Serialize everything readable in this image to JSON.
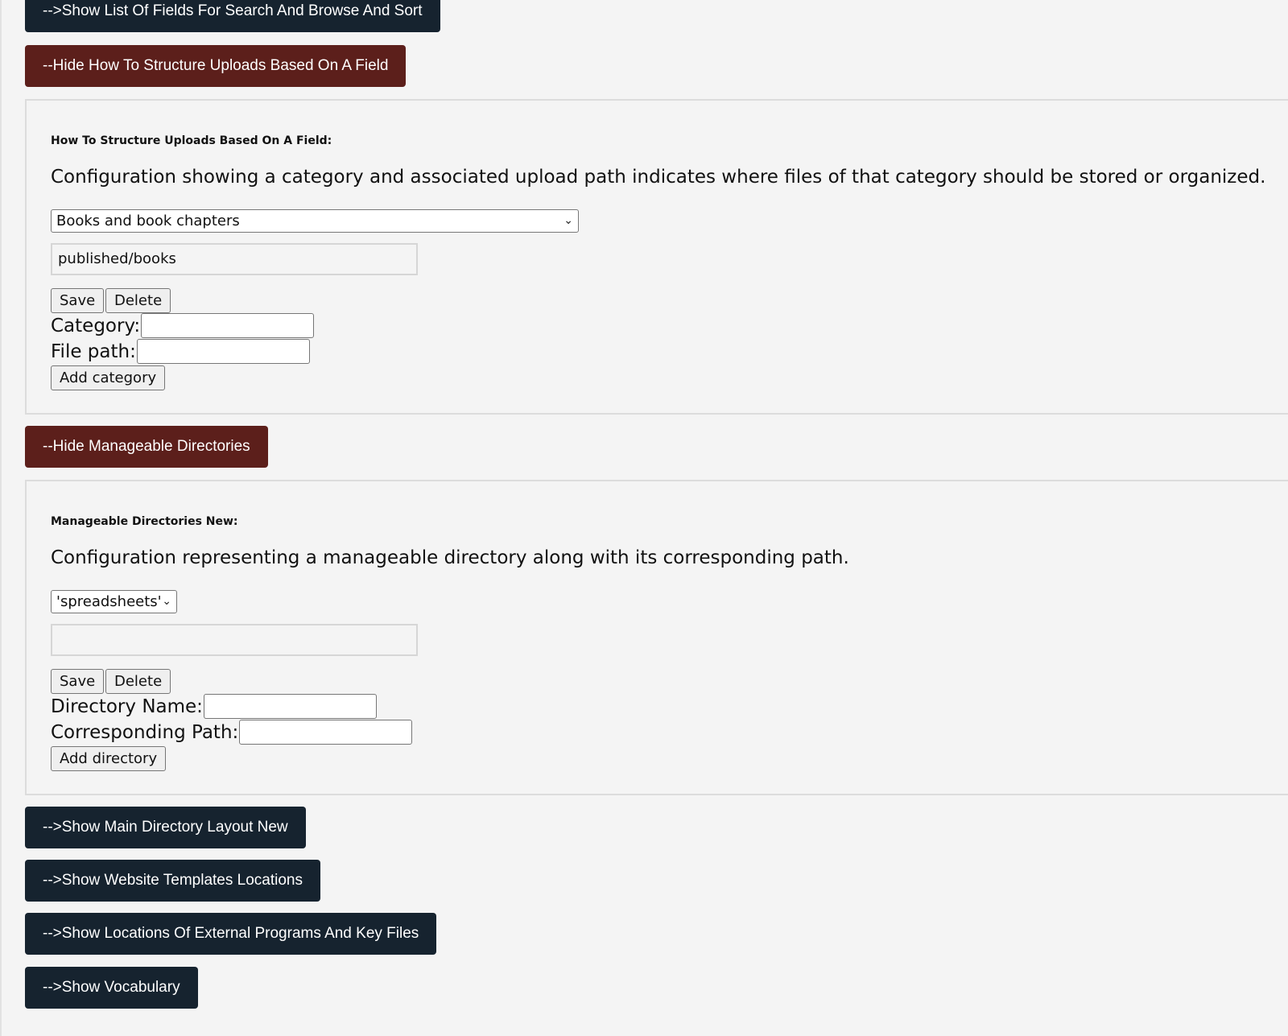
{
  "toggles": {
    "show_fields": "-->Show List Of Fields For Search And Browse And Sort",
    "hide_uploads": "--Hide How To Structure Uploads Based On A Field",
    "hide_dirs": "--Hide Manageable Directories",
    "show_main_layout": "-->Show Main Directory Layout New",
    "show_templates": "-->Show Website Templates Locations",
    "show_external": "-->Show Locations Of External Programs And Key Files",
    "show_vocabulary": "-->Show Vocabulary"
  },
  "colors": {
    "show_button_bg": "#16232f",
    "hide_button_bg": "#5c1f1b",
    "page_bg": "#f4f4f4"
  },
  "uploads_panel": {
    "title": "How To Structure Uploads Based On A Field:",
    "description": "Configuration showing a category and associated upload path indicates where files of that category should be stored or organized.",
    "selected_category": "Books and book chapters",
    "path_value": "published/books",
    "save_label": "Save",
    "delete_label": "Delete",
    "category_label": "Category:",
    "category_value": "",
    "filepath_label": "File path:",
    "filepath_value": "",
    "add_label": "Add category"
  },
  "dirs_panel": {
    "title": "Manageable Directories New:",
    "description": "Configuration representing a manageable directory along with its corresponding path.",
    "selected_directory": "'spreadsheets'",
    "path_value": "",
    "save_label": "Save",
    "delete_label": "Delete",
    "dirname_label": "Directory Name:",
    "dirname_value": "",
    "corrpath_label": "Corresponding Path:",
    "corrpath_value": "",
    "add_label": "Add directory"
  },
  "icons": {
    "dropdown": "chevron-down-icon"
  }
}
